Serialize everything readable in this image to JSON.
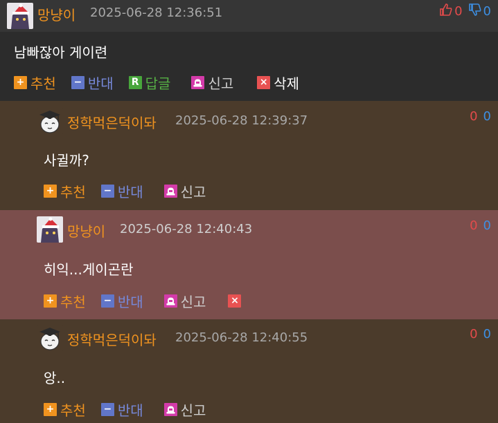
{
  "comments": [
    {
      "nickname": "망냥이",
      "date": "2025-06-28 12:36:51",
      "up": "0",
      "down": "0",
      "text": "남빠잖아 게이련",
      "actions": {
        "recommend": "추천",
        "oppose": "반대",
        "reply": "답글",
        "report": "신고",
        "delete": "삭제"
      }
    },
    {
      "nickname": "정학먹은덕이돠",
      "date": "2025-06-28 12:39:37",
      "up": "0",
      "down": "0",
      "text": "사귈까?",
      "actions": {
        "recommend": "추천",
        "oppose": "반대",
        "report": "신고"
      }
    },
    {
      "nickname": "망냥이",
      "date": "2025-06-28 12:40:43",
      "up": "0",
      "down": "0",
      "text": "히익...게이곤란",
      "actions": {
        "recommend": "추천",
        "oppose": "반대",
        "report": "신고"
      }
    },
    {
      "nickname": "정학먹은덕이돠",
      "date": "2025-06-28 12:40:55",
      "up": "0",
      "down": "0",
      "text": "앙..",
      "actions": {
        "recommend": "추천",
        "oppose": "반대",
        "report": "신고"
      }
    }
  ],
  "icons": {
    "recommend": "+",
    "oppose": "−",
    "reply": "R",
    "delete": "×"
  },
  "colors": {
    "nickname": "#f0931f",
    "up_count": "#e34b4b",
    "down_count": "#3d8fe3",
    "reply_bg": "#4b3b2b",
    "highlight_bg": "#7b4e4c"
  }
}
